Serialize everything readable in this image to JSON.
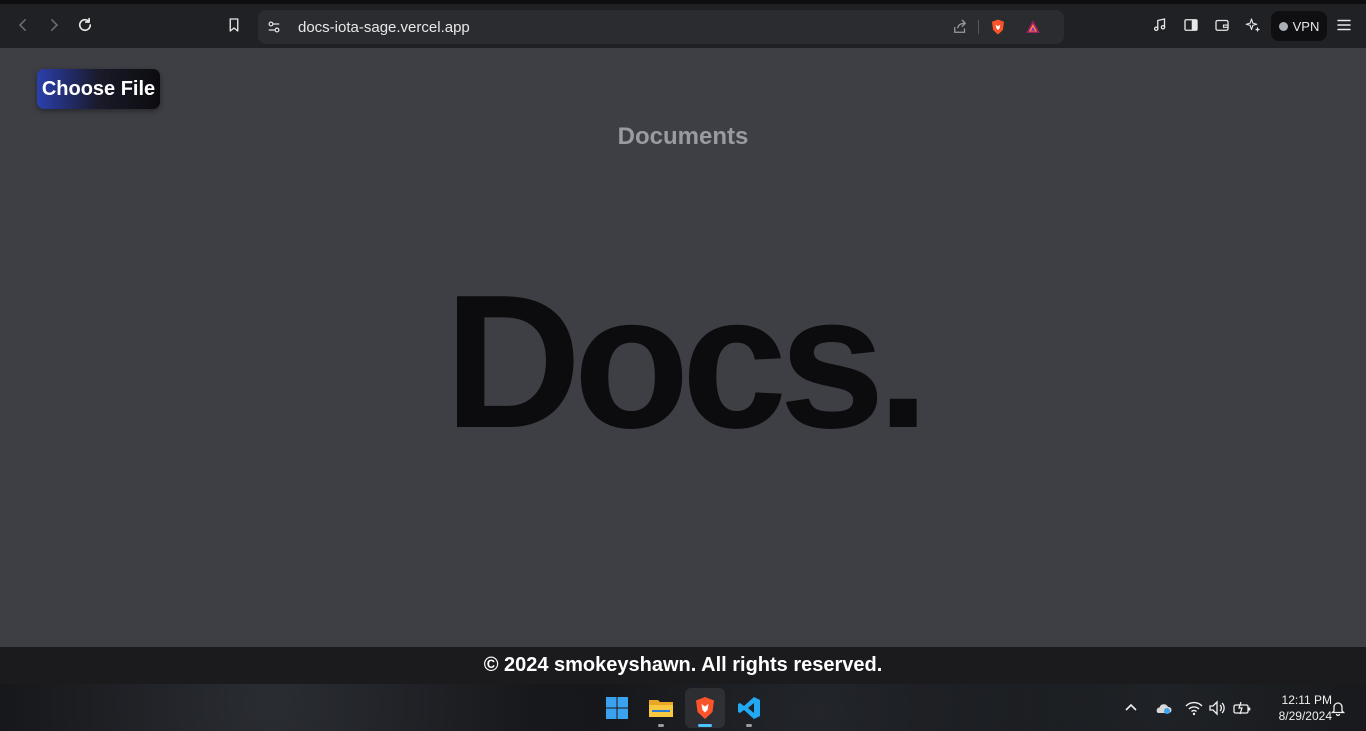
{
  "browser": {
    "url": "docs-iota-sage.vercel.app",
    "vpn_label": "VPN",
    "icons": [
      "back-icon",
      "forward-icon",
      "reload-icon",
      "bookmark-icon",
      "site-settings-icon",
      "share-icon",
      "brave-shields-icon",
      "brave-rewards-icon",
      "media-icon",
      "sidebar-icon",
      "wallet-icon",
      "leo-ai-icon",
      "menu-icon"
    ]
  },
  "page": {
    "choose_file_label": "Choose File",
    "heading": "Documents",
    "logo_text": "Docs.",
    "footer_text": "© 2024 smokeyshawn. All rights reserved."
  },
  "taskbar": {
    "apps": [
      "windows-start-icon",
      "file-explorer-icon",
      "brave-browser-icon",
      "vscode-icon"
    ],
    "time": "12:11 PM",
    "date": "8/29/2024"
  },
  "colors": {
    "page_bg": "#3e3f45",
    "toolbar_bg": "#202124",
    "footer_bg": "#1b1b1e",
    "button_gradient_start": "#2b3fae",
    "brave_orange": "#fb542b",
    "vscode_blue": "#23a9f2"
  }
}
